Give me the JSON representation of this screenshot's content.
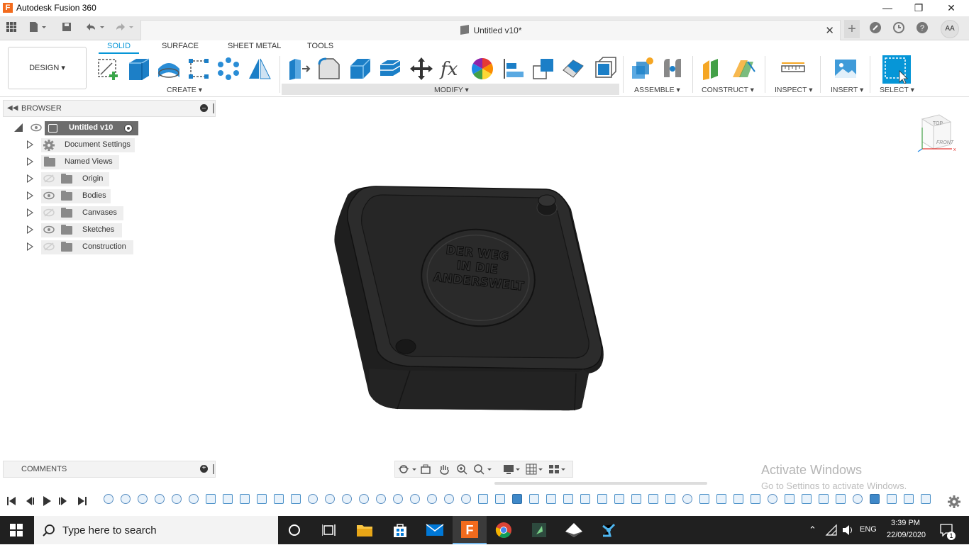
{
  "window": {
    "title": "Autodesk Fusion 360",
    "app_icon": "F"
  },
  "doc_tab": {
    "title": "Untitled v10*"
  },
  "user": {
    "initials": "AA"
  },
  "ribbon": {
    "workspace": "DESIGN ▾",
    "tabs": [
      "SOLID",
      "SURFACE",
      "SHEET METAL",
      "TOOLS"
    ],
    "groups": {
      "create": "CREATE ▾",
      "modify": "MODIFY ▾",
      "assemble": "ASSEMBLE ▾",
      "construct": "CONSTRUCT ▾",
      "inspect": "INSPECT ▾",
      "insert": "INSERT ▾",
      "select": "SELECT ▾"
    }
  },
  "browser": {
    "title": "BROWSER",
    "root": "Untitled v10",
    "items": [
      "Document Settings",
      "Named Views",
      "Origin",
      "Bodies",
      "Canvases",
      "Sketches",
      "Construction"
    ]
  },
  "viewcube": {
    "top": "TOP",
    "front": "FRONT"
  },
  "model": {
    "embossed_text": [
      "DER WEG",
      "IN DIE",
      "ANDERSWELT"
    ]
  },
  "comments": {
    "title": "COMMENTS"
  },
  "watermark": {
    "line1": "Activate Windows",
    "line2": "Go to Settings to activate Windows."
  },
  "taskbar": {
    "search_placeholder": "Type here to search",
    "language": "ENG",
    "time": "3:39 PM",
    "date": "22/09/2020",
    "notifications": "1"
  },
  "colors": {
    "accent": "#0696d7",
    "model": "#2a2a2a",
    "taskbar": "#202020"
  }
}
